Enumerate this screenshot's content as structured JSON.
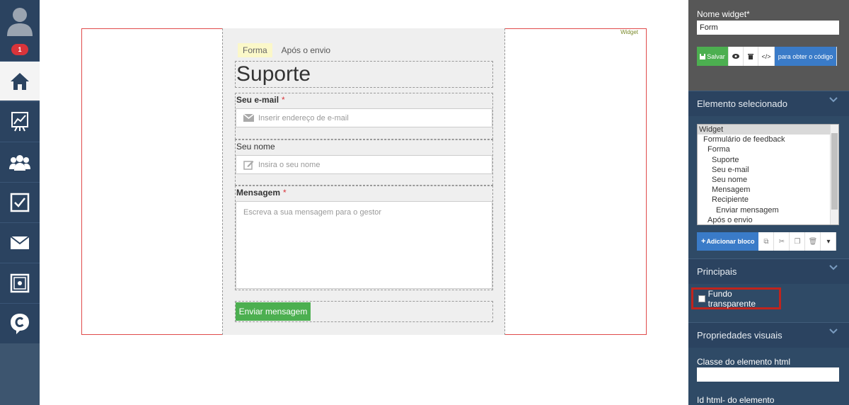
{
  "sidebar": {
    "notification_count": "1",
    "items": [
      {
        "icon": "home-icon"
      },
      {
        "icon": "chart-icon"
      },
      {
        "icon": "users-icon"
      },
      {
        "icon": "checkbox-icon"
      },
      {
        "icon": "mail-icon"
      },
      {
        "icon": "safe-icon"
      },
      {
        "icon": "chat-logo-icon"
      }
    ]
  },
  "canvas": {
    "widget_tag": "Widget",
    "tabs": [
      {
        "label": "Forma"
      },
      {
        "label": "Após o envio"
      }
    ],
    "form_title": "Suporte",
    "email_label": "Seu e-mail",
    "email_required": "*",
    "email_placeholder": "Inserir endereço de e-mail",
    "name_label": "Seu nome",
    "name_placeholder": "Insira o seu nome",
    "message_label": "Mensagem",
    "message_required": "*",
    "message_placeholder": "Escreva a sua mensagem para o gestor",
    "send_button": "Enviar mensagem"
  },
  "panel": {
    "widget_name_label": "Nome widget*",
    "widget_name_value": "Form",
    "save_button": "Salvar",
    "get_code_button": "para obter o código",
    "selected_element_title": "Elemento selecionado",
    "tree": [
      {
        "label": "Widget",
        "indent": 0,
        "selected": true
      },
      {
        "label": "Formulário de feedback",
        "indent": 1
      },
      {
        "label": "Forma",
        "indent": 2
      },
      {
        "label": "Suporte",
        "indent": 3
      },
      {
        "label": "Seu e-mail",
        "indent": 3
      },
      {
        "label": "Seu nome",
        "indent": 3
      },
      {
        "label": "Mensagem",
        "indent": 3
      },
      {
        "label": "Recipiente",
        "indent": 3
      },
      {
        "label": "Enviar mensagem",
        "indent": 4
      },
      {
        "label": "Após o envio",
        "indent": 2
      }
    ],
    "add_block_button": "Adicionar bloco",
    "main_section_title": "Principais",
    "transparent_bg_label": "Fundo transparente",
    "visual_props_title": "Propriedades visuais",
    "html_class_label": "Classe do elemento html",
    "html_class_value": "",
    "html_id_label": "Id html- do elemento"
  },
  "colors": {
    "sidebar_bg": "#2b4360",
    "accent_green": "#4caf50",
    "accent_blue": "#3a7bc8",
    "highlight_red": "#c0241d"
  }
}
